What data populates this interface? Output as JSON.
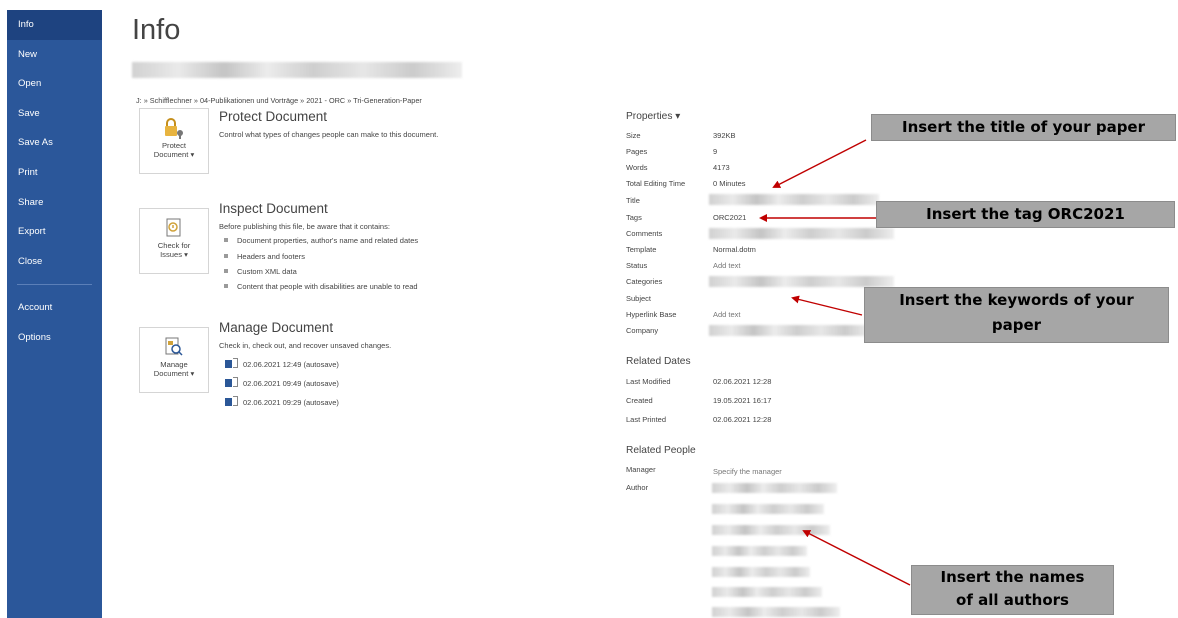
{
  "sidebar": {
    "items": [
      {
        "label": "Info",
        "active": true
      },
      {
        "label": "New"
      },
      {
        "label": "Open"
      },
      {
        "label": "Save"
      },
      {
        "label": "Save As"
      },
      {
        "label": "Print"
      },
      {
        "label": "Share"
      },
      {
        "label": "Export"
      },
      {
        "label": "Close"
      },
      {
        "label": "Account"
      },
      {
        "label": "Options"
      }
    ],
    "color": "#2b579a"
  },
  "header": {
    "title": "Info",
    "path": "J: » Schifflechner » 04-Publikationen und Vorträge » 2021 - ORC » Tri-Generation-Paper"
  },
  "protect": {
    "button_line1": "Protect",
    "button_line2": "Document ▾",
    "title": "Protect Document",
    "desc": "Control what types of changes people can make to this document."
  },
  "inspect": {
    "button_line1": "Check for",
    "button_line2": "Issues ▾",
    "title": "Inspect Document",
    "desc": "Before publishing this file, be aware that it contains:",
    "bullets": [
      "Document properties, author's name and related dates",
      "Headers and footers",
      "Custom XML data",
      "Content that people with disabilities are unable to read"
    ]
  },
  "manage": {
    "button_line1": "Manage",
    "button_line2": "Document ▾",
    "title": "Manage Document",
    "desc": "Check in, check out, and recover unsaved changes.",
    "versions": [
      "02.06.2021 12:49 (autosave)",
      "02.06.2021 09:49 (autosave)",
      "02.06.2021 09:29 (autosave)"
    ]
  },
  "properties": {
    "heading": "Properties ▾",
    "size": {
      "label": "Size",
      "value": "392KB"
    },
    "pages": {
      "label": "Pages",
      "value": "9"
    },
    "words": {
      "label": "Words",
      "value": "4173"
    },
    "editing_time": {
      "label": "Total Editing Time",
      "value": "0 Minutes"
    },
    "title": {
      "label": "Title"
    },
    "tags": {
      "label": "Tags",
      "value": "ORC2021"
    },
    "comments": {
      "label": "Comments"
    },
    "template": {
      "label": "Template",
      "value": "Normal.dotm"
    },
    "status": {
      "label": "Status",
      "value": "Add text"
    },
    "categories": {
      "label": "Categories"
    },
    "subject": {
      "label": "Subject"
    },
    "hyperlink_base": {
      "label": "Hyperlink Base",
      "value": "Add text"
    },
    "company": {
      "label": "Company"
    }
  },
  "related_dates": {
    "heading": "Related Dates",
    "last_modified": {
      "label": "Last Modified",
      "value": "02.06.2021 12:28"
    },
    "created": {
      "label": "Created",
      "value": "19.05.2021 16:17"
    },
    "last_printed": {
      "label": "Last Printed",
      "value": "02.06.2021 12:28"
    }
  },
  "related_people": {
    "heading": "Related People",
    "manager": {
      "label": "Manager",
      "value": "Specify the manager"
    },
    "author": {
      "label": "Author"
    }
  },
  "callouts": {
    "title": "Insert the title of your paper",
    "tag": "Insert the tag ORC2021",
    "keywords_line1": "Insert the keywords of your",
    "keywords_line2": "paper",
    "authors_line1": "Insert the names",
    "authors_line2": "of all authors",
    "arrow_color": "#c00000",
    "box_color": "#a6a6a6"
  }
}
